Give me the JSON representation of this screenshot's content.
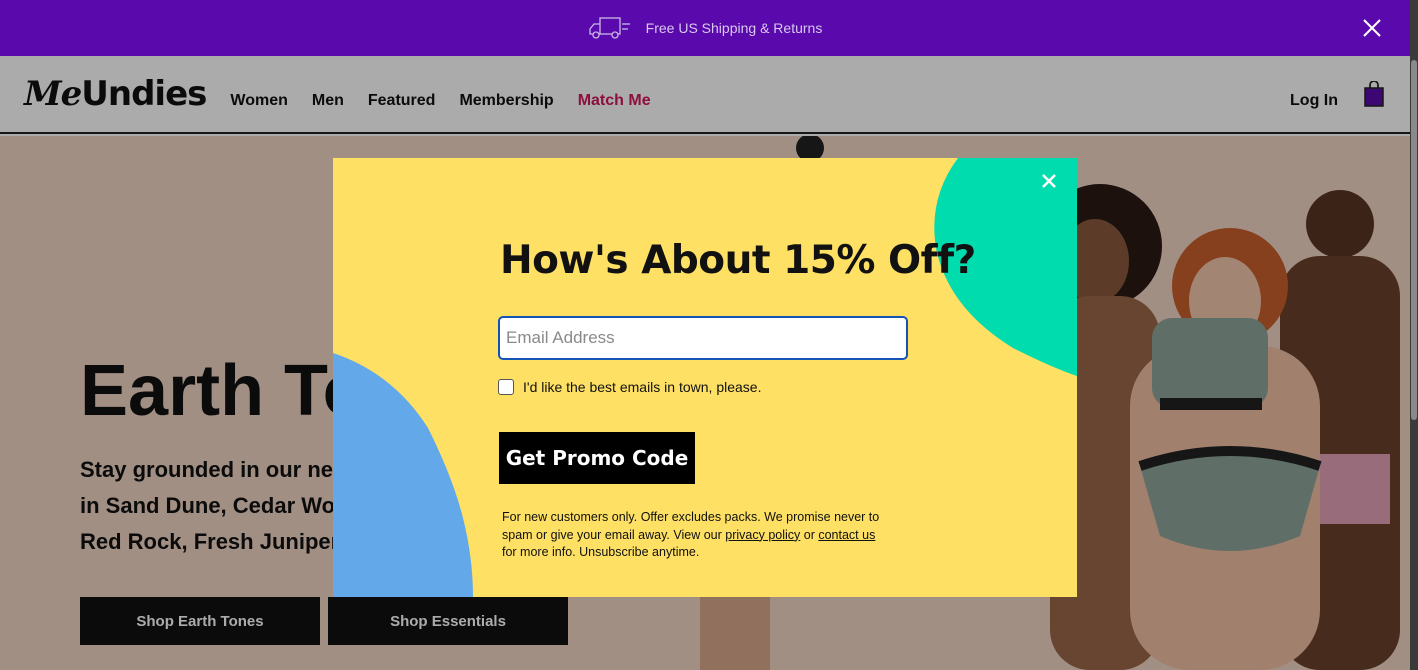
{
  "announcement": {
    "text": "Free US Shipping & Returns",
    "icons": {
      "truck": "truck-icon",
      "close": "close-icon"
    },
    "bg_color": "#5a0aac"
  },
  "header": {
    "logo_script": "Me",
    "logo_text": "Undies",
    "nav": [
      {
        "label": "Women"
      },
      {
        "label": "Men"
      },
      {
        "label": "Featured"
      },
      {
        "label": "Membership"
      },
      {
        "label": "Match Me"
      }
    ],
    "login_label": "Log In",
    "bag_icon": "shopping-bag-icon",
    "accent_color": "#d1175c"
  },
  "hero": {
    "title": "Earth Tones",
    "subtitle_lines": [
      "Stay grounded in our new",
      "in Sand Dune, Cedar Wood,",
      "Red Rock, Fresh Juniper"
    ],
    "buttons": [
      {
        "label": "Shop Earth Tones"
      },
      {
        "label": "Shop Essentials"
      }
    ]
  },
  "modal": {
    "title": "How's About 15% Off?",
    "email_placeholder": "Email Address",
    "email_value": "",
    "optin_label": "I'd like the best emails in town, please.",
    "optin_checked": false,
    "cta_label": "Get Promo Code",
    "fine_print": {
      "part1": "For new customers only. Offer excludes packs. We promise never to spam or give your email away. View our ",
      "privacy_link": "privacy policy",
      "part2": " or ",
      "contact_link": "contact us",
      "part3": " for more info. Unsubscribe anytime."
    },
    "close_icon": "close-icon",
    "colors": {
      "bg": "#fee064",
      "green": "#00dcae",
      "blue": "#63a8e8"
    }
  }
}
